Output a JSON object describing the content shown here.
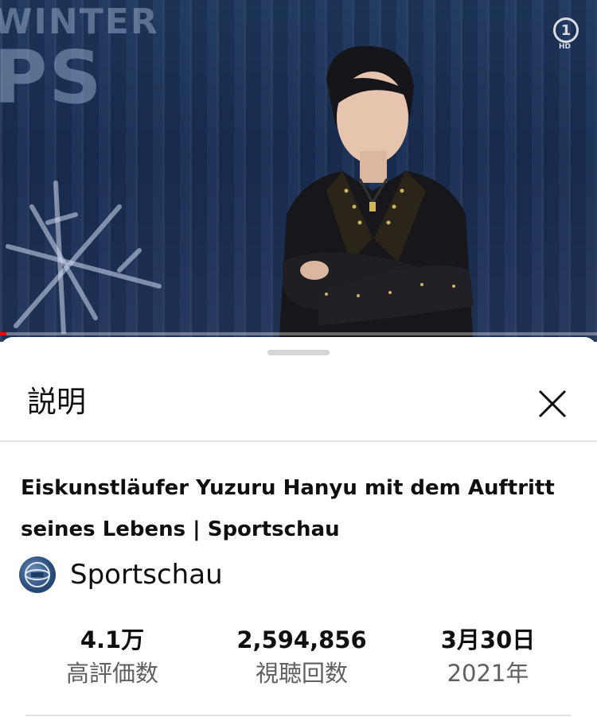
{
  "video": {
    "venue_text_top": "WINTER",
    "venue_text_big": "PS",
    "channel_badge": "1",
    "channel_badge_hd": "HD",
    "progress_fraction": 0.01
  },
  "description_sheet": {
    "title": "説明",
    "close_icon": "close-icon",
    "video_title": "Eiskunstläufer Yuzuru Hanyu mit dem Auftritt seines Lebens | Sportschau",
    "channel": {
      "avatar_icon": "globe-icon",
      "name": "Sportschau"
    },
    "stats": [
      {
        "value": "4.1万",
        "label": "高評価数"
      },
      {
        "value": "2,594,856",
        "label": "視聴回数"
      },
      {
        "value": "3月30日",
        "label": "2021年"
      }
    ]
  },
  "colors": {
    "progress": "#ff0000",
    "video_bg": "#1a2f55",
    "secondary_text": "#606060"
  }
}
